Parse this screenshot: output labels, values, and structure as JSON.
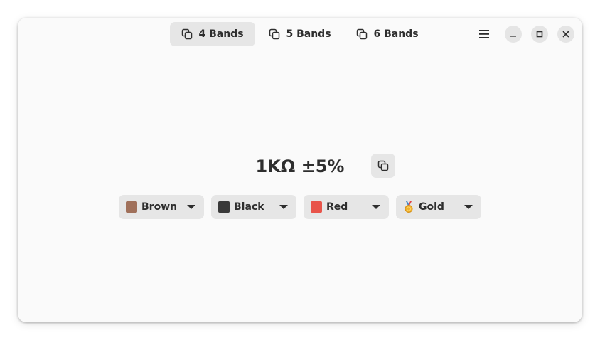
{
  "header": {
    "tabs": [
      {
        "label": "4 Bands",
        "active": true
      },
      {
        "label": "5 Bands",
        "active": false
      },
      {
        "label": "6 Bands",
        "active": false
      }
    ],
    "menu_icon": "hamburger-icon",
    "window_controls": [
      "minimize-icon",
      "maximize-icon",
      "close-icon"
    ]
  },
  "main": {
    "result": "1KΩ ±5%",
    "copy_icon": "copy-icon",
    "bands": [
      {
        "label": "Brown",
        "emoji": "brown-square",
        "color": "#a0705a"
      },
      {
        "label": "Black",
        "emoji": "black-square",
        "color": "#3a3a3a"
      },
      {
        "label": "Red",
        "emoji": "red-square",
        "color": "#e8544a"
      },
      {
        "label": "Gold",
        "emoji": "gold-medal",
        "color": "#f0b02c"
      }
    ]
  },
  "colors": {
    "window_bg": "#fafafa",
    "button_bg": "#e6e6e6",
    "text": "#2e2e2e"
  }
}
